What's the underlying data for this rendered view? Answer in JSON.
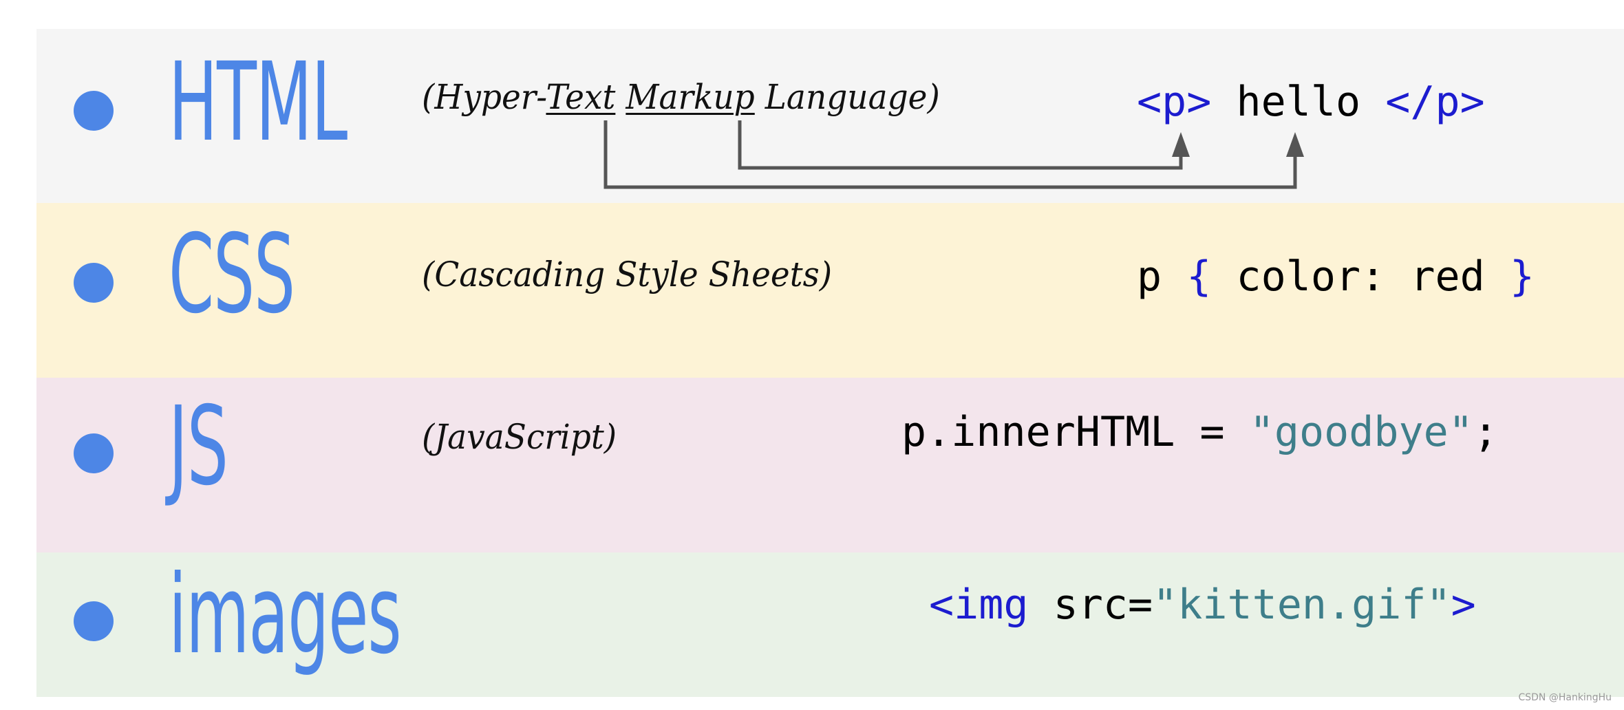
{
  "colors": {
    "accent": "#4d86e6",
    "code_keyword": "#1c1ccf",
    "code_string": "#3e7e8a",
    "band_html": "#f5f5f5",
    "band_css": "#fdf3d6",
    "band_js": "#f3e5ec",
    "band_images": "#e9f2e7",
    "connector": "#555555"
  },
  "rows": {
    "html": {
      "term": "HTML",
      "exp_open": "(Hyper-",
      "exp_text": "Text",
      "exp_markup": "Markup",
      "exp_close": " Language)",
      "code_open_tag": "<p>",
      "code_content": " hello ",
      "code_close_tag": "</p>"
    },
    "css": {
      "term": "CSS",
      "expansion": "(Cascading Style Sheets)",
      "code_selector": "p ",
      "code_brace_open": "{",
      "code_decl": " color: red ",
      "code_brace_close": "}"
    },
    "js": {
      "term": "JS",
      "expansion": "(JavaScript)",
      "code_stmt": "p.innerHTML = ",
      "code_string": "\"goodbye\"",
      "code_end": ";"
    },
    "images": {
      "term": "images",
      "code_tag_open": "<img",
      "code_attr": " src=",
      "code_value": "\"kitten.gif\"",
      "code_tag_close": ">"
    }
  },
  "watermark": "CSDN @HankingHu"
}
